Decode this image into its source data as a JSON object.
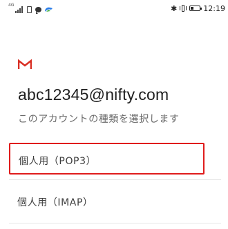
{
  "status_bar": {
    "network_type": "4G",
    "time": "12:19",
    "icons": [
      "signal-icon",
      "sim-icon",
      "chat-icon",
      "app-icon",
      "bluetooth-icon",
      "vibrate-icon",
      "battery-icon"
    ]
  },
  "colors": {
    "gmail_red": "#d93025",
    "highlight_border": "#e01b1b",
    "divider": "#e6e6e6"
  },
  "account": {
    "email": "abc12345@nifty.com",
    "subtitle": "このアカウントの種類を選択します"
  },
  "options": [
    {
      "label": "個人用（POP3）"
    },
    {
      "label": "個人用（IMAP）"
    }
  ]
}
